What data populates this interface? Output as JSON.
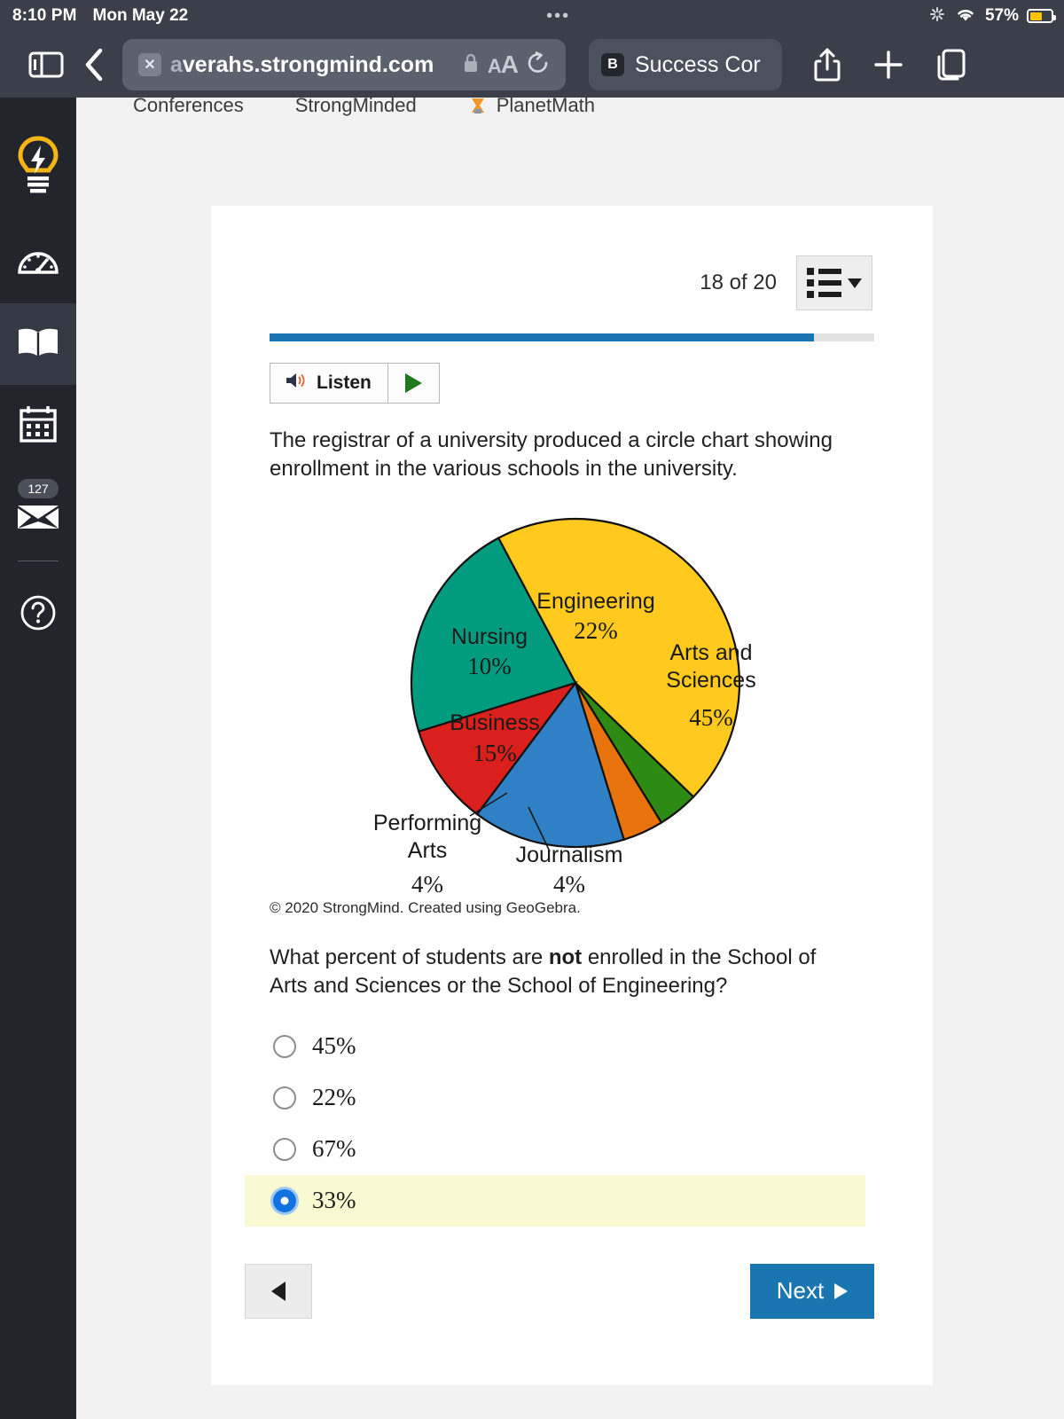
{
  "status_bar": {
    "time": "8:10 PM",
    "date": "Mon May 22",
    "dots": "•••",
    "battery_percent": "57%",
    "battery_level": 57,
    "wifi_icon": "wifi-icon",
    "spinner_icon": "activity-spinner-icon",
    "battery_icon": "battery-icon",
    "battery_color": "#fcc400"
  },
  "browser": {
    "sidebar_toggle_icon": "sidebar-toggle-icon",
    "back_icon": "back-chevron-icon",
    "url_prefix": "a",
    "url": "verahs.strongmind.com",
    "url_full": "averahs.strongmind.com",
    "close_tab_icon": "close-tab-icon",
    "lock_icon": "lock-icon",
    "text_size_label": "AA",
    "reload_icon": "reload-icon",
    "tab2_favicon_letter": "B",
    "tab2_title": "Success Cor",
    "share_icon": "share-icon",
    "new_tab_icon": "plus-icon",
    "tabs_overview_icon": "tabs-overview-icon"
  },
  "bookmarks": [
    {
      "label": "Conferences",
      "icon": ""
    },
    {
      "label": "StrongMinded",
      "icon": ""
    },
    {
      "label": "PlanetMath",
      "icon": "planetmath-favicon"
    }
  ],
  "rail": {
    "items": [
      {
        "name": "lightbulb",
        "label": "",
        "icon": "lightbulb-icon",
        "active": false,
        "color": "#f5b417"
      },
      {
        "name": "dashboard",
        "label": "",
        "icon": "speedometer-icon",
        "active": false
      },
      {
        "name": "courses",
        "label": "",
        "icon": "open-book-icon",
        "active": true
      },
      {
        "name": "calendar",
        "label": "",
        "icon": "calendar-icon",
        "active": false
      },
      {
        "name": "inbox",
        "label": "",
        "icon": "mail-icon",
        "active": false,
        "badge": "127"
      },
      {
        "name": "help",
        "label": "",
        "icon": "question-mark-icon",
        "active": false
      }
    ],
    "expand_icon": "chevron-right-icon"
  },
  "lesson": {
    "progress_label": "18 of 20",
    "progress_percent": 90,
    "menu_icon": "list-menu-icon",
    "listen_label": "Listen",
    "listen_icon": "speaker-icon",
    "play_icon": "play-icon",
    "prompt": "The registrar of a university produced a circle chart showing enrollment in the various schools in the university.",
    "credit": "© 2020 StrongMind. Created using GeoGebra.",
    "question_part1": "What percent of students are ",
    "question_bold": "not",
    "question_part2": " enrolled in the School of Arts and Sciences or the School of Engineering?",
    "choices": [
      {
        "label": "45%",
        "selected": false
      },
      {
        "label": "22%",
        "selected": false
      },
      {
        "label": "67%",
        "selected": false
      },
      {
        "label": "33%",
        "selected": true
      }
    ],
    "prev_label": "",
    "prev_icon": "left-triangle-icon",
    "next_label": "Next",
    "next_icon": "right-triangle-icon",
    "accent_color": "#1a76b0",
    "selected_row_color": "#fafad2"
  },
  "chart_data": {
    "type": "pie",
    "title": "",
    "categories": [
      "Arts and Sciences",
      "Journalism",
      "Performing Arts",
      "Business",
      "Nursing",
      "Engineering"
    ],
    "values": [
      45,
      4,
      4,
      15,
      10,
      22
    ],
    "labels": [
      {
        "name": "Arts and Sciences",
        "value": 45,
        "text": "45%",
        "color": "#ffc91e",
        "inside": true
      },
      {
        "name": "Journalism",
        "value": 4,
        "text": "4%",
        "color": "#2d8a12",
        "inside": false
      },
      {
        "name": "Performing Arts",
        "value": 4,
        "text": "4%",
        "color": "#e8720c",
        "inside": false
      },
      {
        "name": "Business",
        "value": 15,
        "text": "15%",
        "color": "#2f80c4",
        "inside": true
      },
      {
        "name": "Nursing",
        "value": 10,
        "text": "10%",
        "color": "#d9201c",
        "inside": true
      },
      {
        "name": "Engineering",
        "value": 22,
        "text": "22%",
        "color": "#019b7f",
        "inside": true
      }
    ],
    "legend": "none",
    "units": "percent",
    "total": 100
  }
}
